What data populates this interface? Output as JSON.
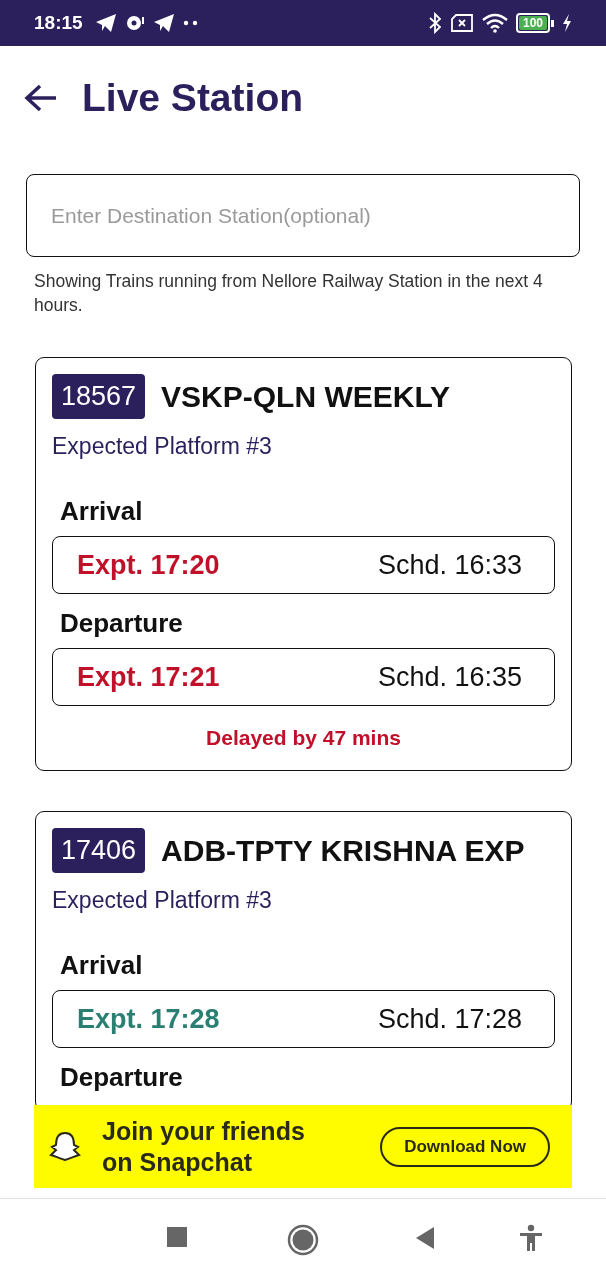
{
  "status_bar": {
    "time": "18:15",
    "battery": "100"
  },
  "header": {
    "title": "Live Station"
  },
  "search": {
    "placeholder": "Enter Destination Station(optional)"
  },
  "info": "Showing Trains running from Nellore Railway Station in the next 4 hours.",
  "trains": [
    {
      "number": "18567",
      "name": "VSKP-QLN WEEKLY",
      "platform": "Expected Platform #3",
      "arrival": {
        "label": "Arrival",
        "color": "#c0102a",
        "expected": "Expt. 17:20",
        "scheduled": "Schd. 16:33"
      },
      "departure": {
        "label": "Departure",
        "color": "#c0102a",
        "expected": "Expt. 17:21",
        "scheduled": "Schd. 16:35"
      },
      "delay": "Delayed by 47 mins"
    },
    {
      "number": "17406",
      "name": "ADB-TPTY KRISHNA EXP",
      "platform": "Expected Platform #3",
      "arrival": {
        "label": "Arrival",
        "color": "#2a7f72",
        "expected": "Expt. 17:28",
        "scheduled": "Schd. 17:28"
      },
      "departure": {
        "label": "Departure"
      }
    }
  ],
  "ad": {
    "text": "Join your friends on Snapchat",
    "button": "Download Now"
  }
}
